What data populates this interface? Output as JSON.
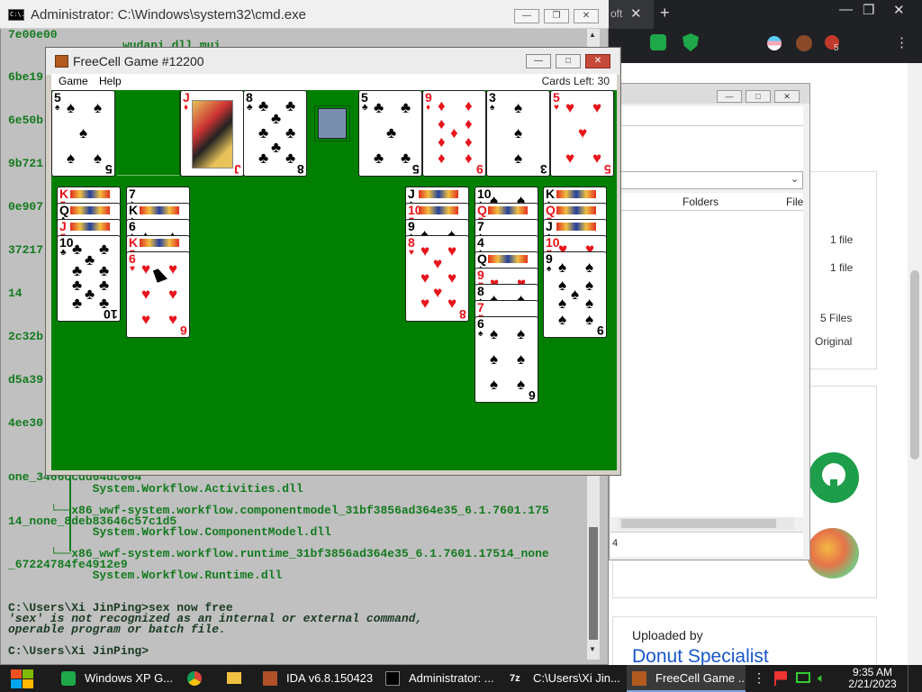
{
  "browser": {
    "tab_fragment": "oft",
    "explorer": {
      "col_folders": "Folders",
      "col_file": "File",
      "row1": "1 file",
      "row2": "1 file",
      "row3": "5 Files",
      "row4": "Original",
      "status": "4"
    },
    "uploaded_by_label": "Uploaded by",
    "uploader": "Donut Specialist",
    "profile_badge": "5"
  },
  "cmd": {
    "title": "Administrator: C:\\Windows\\system32\\cmd.exe",
    "icon_text": "C:\\.",
    "left_column": [
      "7e00e00",
      "6be19",
      "6e50b",
      "9b721",
      "0e907",
      "37217",
      "14",
      "2c32b",
      "d5a39",
      "4ee30"
    ],
    "line_wudapi": "wudapi.dll.mui",
    "lines": [
      "one_3466ccdd64dc064",
      "            System.Workflow.Activities.dll",
      "      └──x86_wwf-system.workflow.componentmodel_31bf3856ad364e35_6.1.7601.175",
      "14_none_8deb83646c57c1d5",
      "            System.Workflow.ComponentModel.dll",
      "      └──x86_wwf-system.workflow.runtime_31bf3856ad364e35_6.1.7601.17514_none",
      "_67224784fe4912e9",
      "            System.Workflow.Runtime.dll",
      "",
      "C:\\Users\\Xi JinPing>sex now free",
      "'sex' is not recognized as an internal or external command,",
      "operable program or batch file.",
      "",
      "C:\\Users\\Xi JinPing>"
    ]
  },
  "freecell": {
    "title": "FreeCell Game #12200",
    "menu": [
      "Game",
      "Help"
    ],
    "cards_left": "Cards Left: 30"
  },
  "taskbar": {
    "items": [
      "Windows XP G...",
      "IDA v6.8.150423",
      "Administrator: ...",
      "C:\\Users\\Xi Jin...",
      "FreeCell Game ..."
    ],
    "time": "9:35 AM",
    "date": "2/21/2023"
  },
  "colors": {
    "felt": "#007f00",
    "cmd_text": "#137a1e",
    "red_suit": "#e8141b",
    "link": "#1a56c8"
  }
}
